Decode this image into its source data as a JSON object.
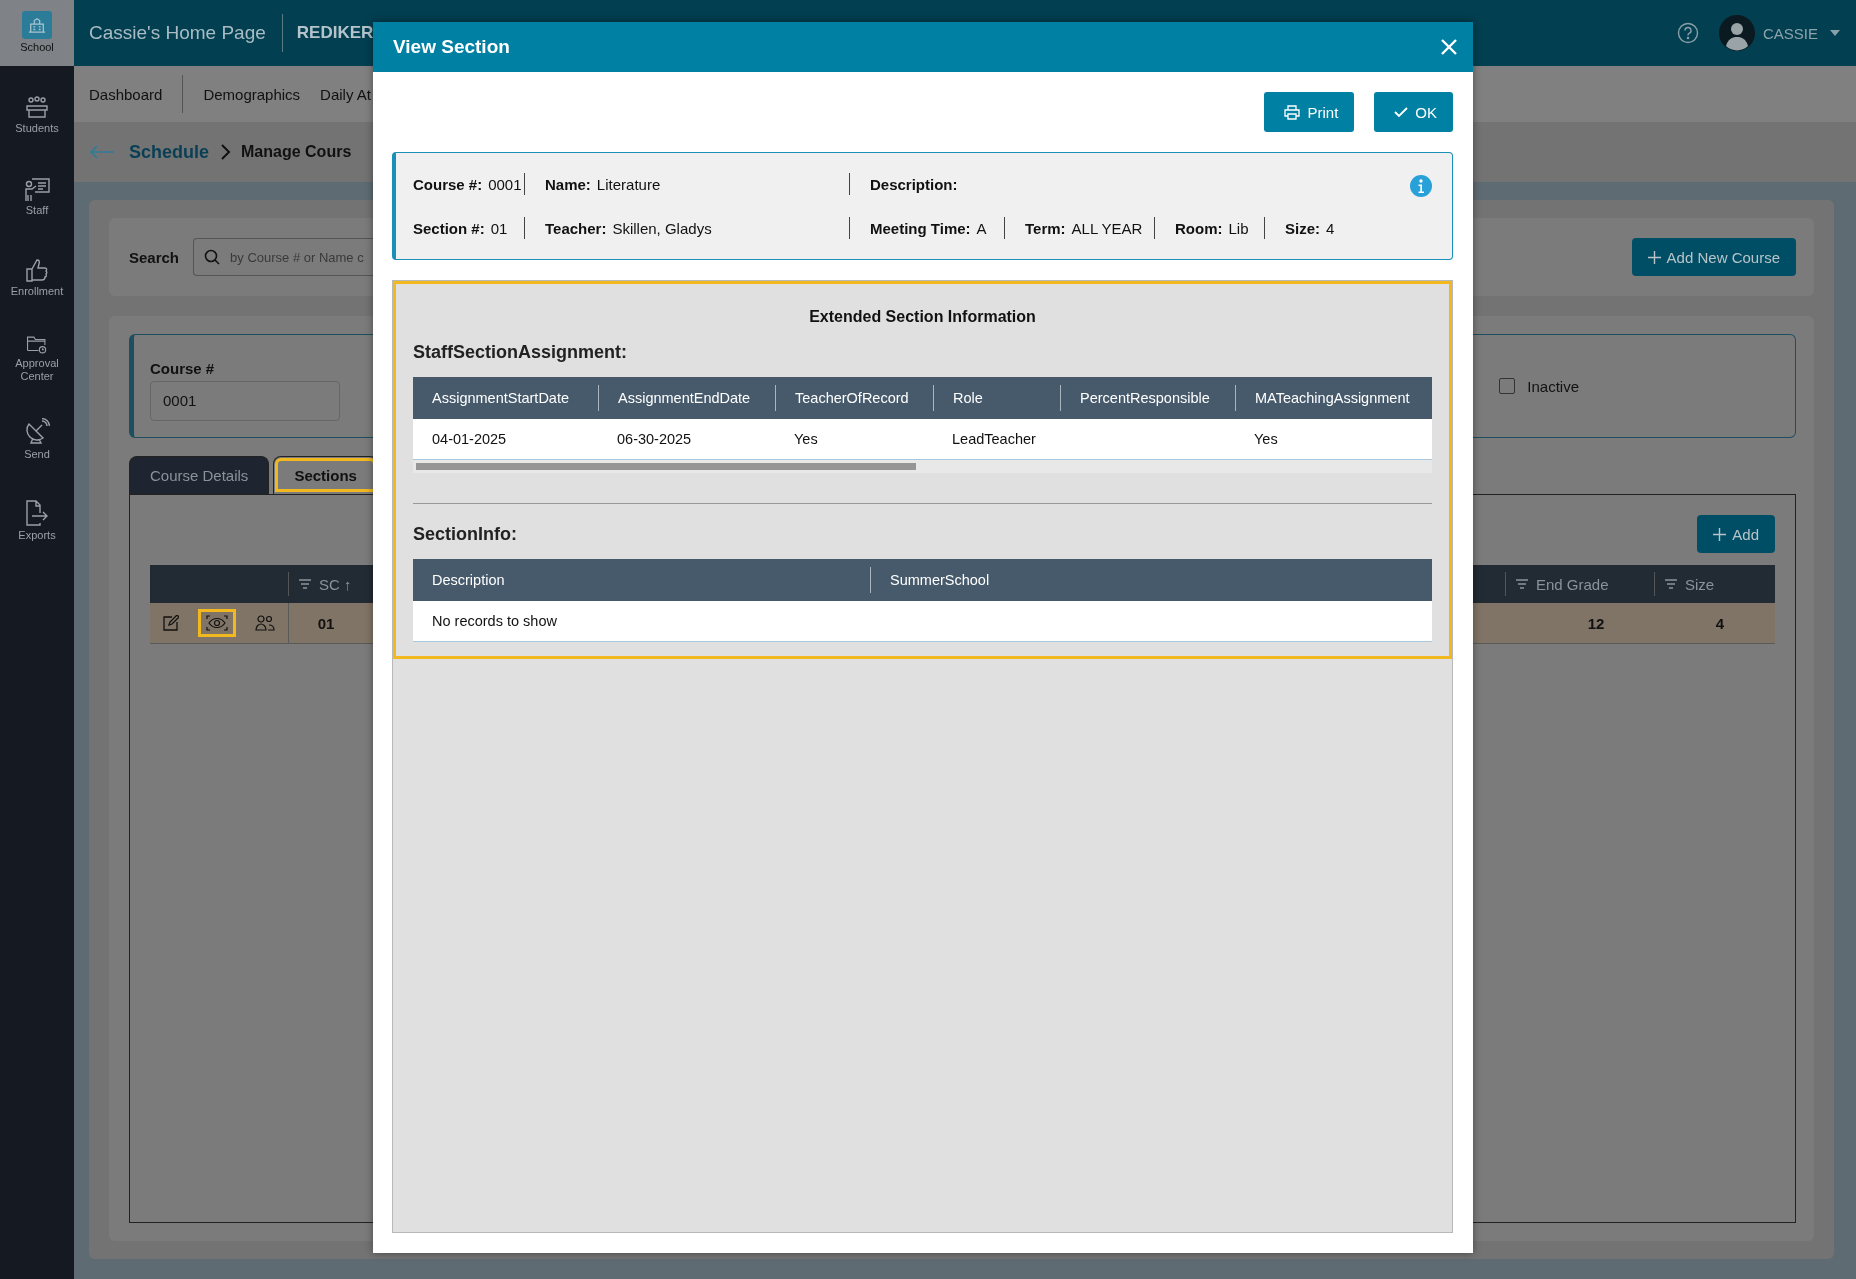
{
  "sidebar": {
    "items": [
      {
        "kind": "school",
        "label": "School",
        "selected": true
      },
      {
        "kind": "students",
        "label": "Students",
        "selected": false
      },
      {
        "kind": "staff",
        "label": "Staff",
        "selected": false
      },
      {
        "kind": "enrollment",
        "label": "Enrollment",
        "selected": false
      },
      {
        "kind": "approval",
        "label": "Approval Center",
        "selected": false
      },
      {
        "kind": "send",
        "label": "Send",
        "selected": false
      },
      {
        "kind": "exports",
        "label": "Exports",
        "selected": false
      }
    ]
  },
  "header": {
    "title": "Cassie's Home Page",
    "brand": "REDIKER",
    "user": "CASSIE"
  },
  "nav": {
    "items": [
      "Dashboard",
      "Demographics",
      "Daily At"
    ]
  },
  "breadcrumb": {
    "parent": "Schedule",
    "current": "Manage Cours"
  },
  "search": {
    "label": "Search",
    "placeholder": "by Course # or Name c",
    "add_button": "Add New Course"
  },
  "course_form": {
    "course_label": "Course #",
    "course_value": "0001",
    "inactive": {
      "label": "Inactive",
      "checked": false
    }
  },
  "tabs": [
    {
      "label": "Course Details",
      "selected": false,
      "highlighted": false
    },
    {
      "label": "Sections",
      "selected": true,
      "highlighted": true
    }
  ],
  "sections_table": {
    "add_button": "Add",
    "left_columns": [
      "SC ↑"
    ],
    "right_columns": [
      "End Grade",
      "Size"
    ],
    "rows": [
      {
        "actions": [
          {
            "kind": "edit",
            "highlighted": false
          },
          {
            "kind": "view",
            "highlighted": true
          },
          {
            "kind": "people",
            "highlighted": false
          }
        ],
        "sc": "01",
        "end_grade": "12",
        "size": "4"
      }
    ]
  },
  "modal": {
    "title": "View Section",
    "buttons": [
      {
        "kind": "print",
        "label": "Print"
      },
      {
        "kind": "ok",
        "label": "OK"
      }
    ],
    "info": {
      "rows": [
        [
          {
            "label": "Course #:",
            "value": "0001"
          },
          {
            "label": "Name:",
            "value": "Literature"
          },
          {
            "label": "Description:"
          }
        ],
        [
          {
            "label": "Section #:",
            "value": "01"
          },
          {
            "label": "Teacher:",
            "value": "Skillen, Gladys"
          },
          {
            "label": "Meeting Time:",
            "value": "A"
          },
          {
            "label": "Term:",
            "value": "ALL YEAR"
          },
          {
            "label": "Room:",
            "value": "Lib"
          },
          {
            "label": "Size:",
            "value": "4"
          }
        ]
      ]
    },
    "extended": {
      "title": "Extended Section Information",
      "highlighted": true,
      "tables": [
        {
          "title": "StaffSectionAssignment:",
          "columns": [
            "AssignmentStartDate",
            "AssignmentEndDate",
            "TeacherOfRecord",
            "Role",
            "PercentResponsible",
            "MATeachingAssignment"
          ],
          "rows": [
            [
              "04-01-2025",
              "06-30-2025",
              "Yes",
              "LeadTeacher",
              "",
              "Yes"
            ]
          ],
          "scrollbar": true
        },
        {
          "title": "SectionInfo:",
          "columns": [
            "Description",
            "SummerSchool"
          ],
          "empty_text": "No records to show"
        }
      ]
    }
  }
}
